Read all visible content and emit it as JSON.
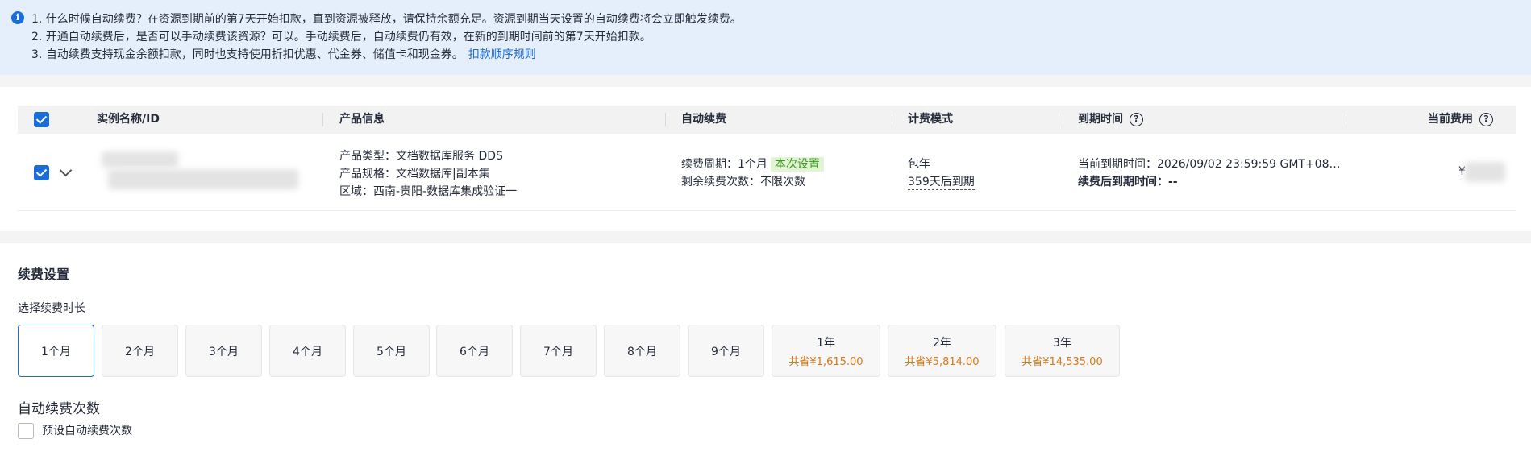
{
  "notice": {
    "line1": "1. 什么时候自动续费？在资源到期前的第7天开始扣款，直到资源被释放，请保持余额充足。资源到期当天设置的自动续费将会立即触发续费。",
    "line2": "2. 开通自动续费后，是否可以手动续费该资源？可以。手动续费后，自动续费仍有效，在新的到期时间前的第7天开始扣款。",
    "line3": "3. 自动续费支持现金余额扣款，同时也支持使用折扣优惠、代金券、储值卡和现金券。",
    "link": "扣款顺序规则"
  },
  "table": {
    "headers": {
      "name": "实例名称/ID",
      "product": "产品信息",
      "renew": "自动续费",
      "billing": "计费模式",
      "expire": "到期时间",
      "cost": "当前费用"
    },
    "row": {
      "product_type": "产品类型：文档数据库服务 DDS",
      "product_spec": "产品规格：文档数据库|副本集",
      "region": "区域：西南-贵阳-数据库集成验证一",
      "renew_period": "续费周期：1个月",
      "renew_tag": "本次设置",
      "renew_count": "剩余续费次数：不限次数",
      "billing_mode": "包年",
      "billing_days": "359天后到期",
      "expire_current": "当前到期时间：2026/09/02 23:59:59 GMT+08…",
      "expire_after": "续费后到期时间：--",
      "cost_symbol": "¥"
    }
  },
  "settings": {
    "title": "续费设置",
    "duration_label": "选择续费时长",
    "durations": [
      {
        "name": "1个月",
        "save": ""
      },
      {
        "name": "2个月",
        "save": ""
      },
      {
        "name": "3个月",
        "save": ""
      },
      {
        "name": "4个月",
        "save": ""
      },
      {
        "name": "5个月",
        "save": ""
      },
      {
        "name": "6个月",
        "save": ""
      },
      {
        "name": "7个月",
        "save": ""
      },
      {
        "name": "8个月",
        "save": ""
      },
      {
        "name": "9个月",
        "save": ""
      },
      {
        "name": "1年",
        "save": "共省¥1,615.00"
      },
      {
        "name": "2年",
        "save": "共省¥5,814.00"
      },
      {
        "name": "3年",
        "save": "共省¥14,535.00"
      }
    ],
    "selected": "1个月",
    "count_label": "自动续费次数",
    "preset_label": "预设自动续费次数"
  },
  "colors": {
    "accent": "#1a6dd9",
    "notice_bg": "#e5effc",
    "saving_text": "#e07715",
    "tag_green": "#3d9a1e"
  }
}
